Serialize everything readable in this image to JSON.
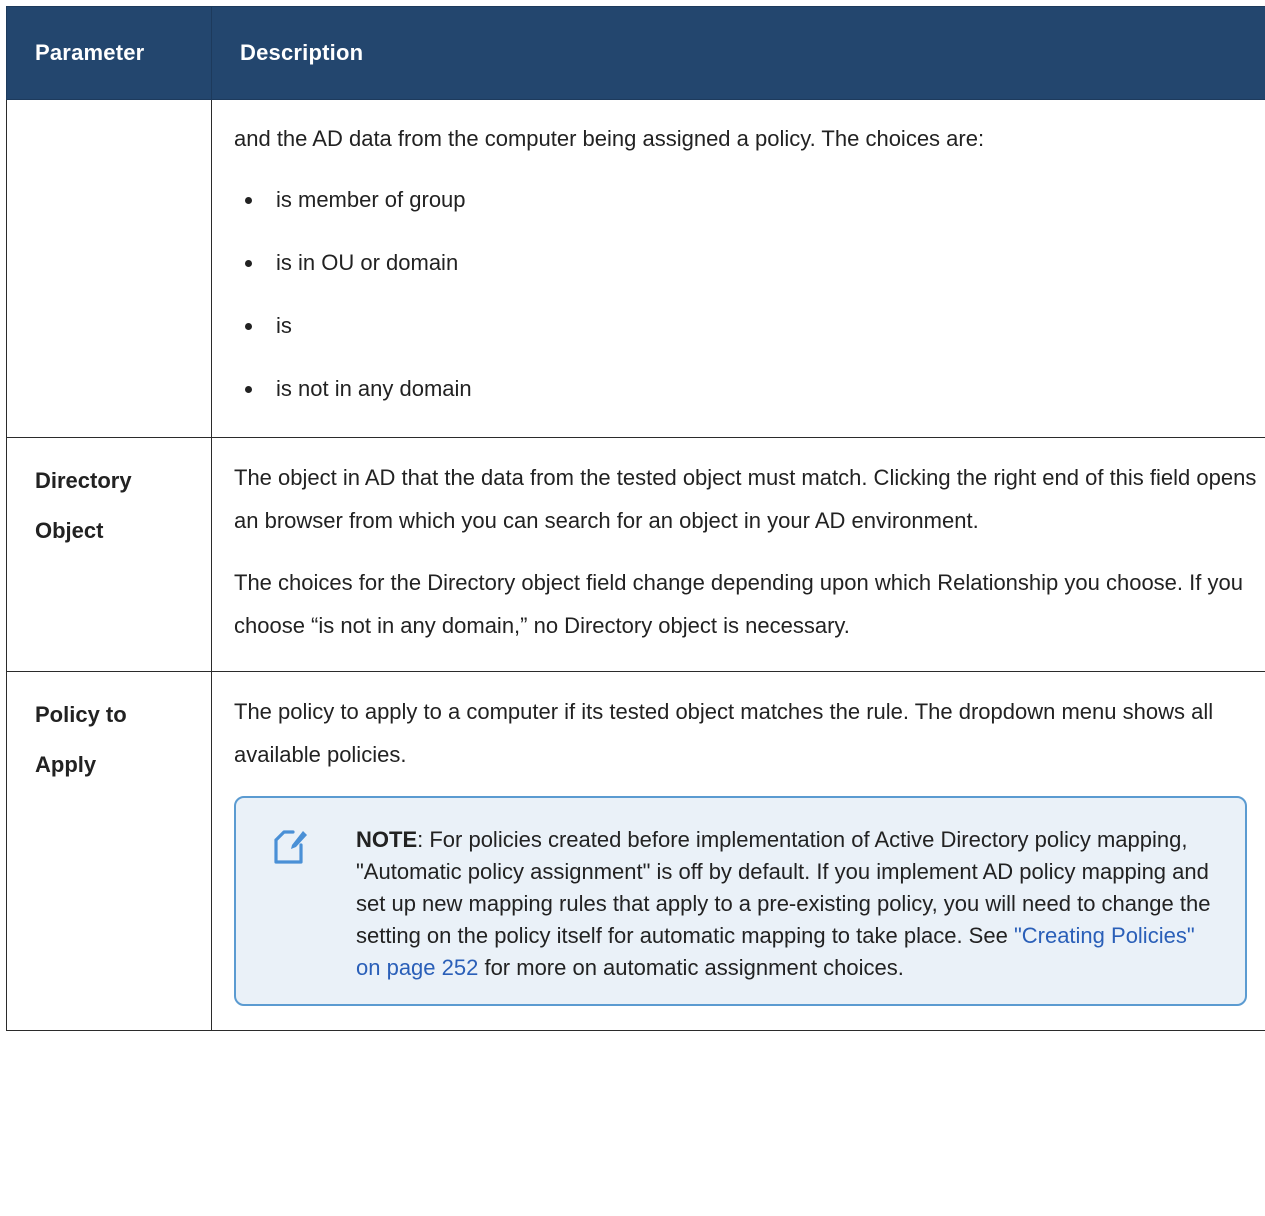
{
  "table": {
    "headers": [
      "Parameter",
      "Description"
    ],
    "rows": {
      "relationship": {
        "name": "",
        "intro": "and the AD data from the computer being assigned a policy. The choices are:",
        "choices": [
          "is member of group",
          "is in OU or domain",
          "is",
          "is not in any domain"
        ]
      },
      "directory_object": {
        "name": "Directory Object",
        "p1": "The object in AD that the data from the tested object must match. Clicking the right end of this field opens an browser from which you can search for an object in your AD environment.",
        "p2": "The choices for the Directory object field change depending upon which Relationship you choose. If you choose “is not in any domain,” no Directory object is necessary."
      },
      "policy_to_apply": {
        "name": "Policy to Apply",
        "p1": "The policy to apply to a computer if its tested object matches the rule. The dropdown menu shows all available policies.",
        "note": {
          "icon": "note-edit-icon",
          "label": "NOTE",
          "text_before": ": For policies created before implementation of Active Directory policy mapping, \"Automatic policy assignment\" is off by default. If you implement AD policy mapping and set up new mapping rules that apply to a pre-existing policy, you will need to change the setting on the policy itself for automatic mapping to take place. See ",
          "link": "\"Creating Policies\" on page 252",
          "text_after": " for more on automatic assignment choices."
        }
      }
    }
  },
  "colors": {
    "header_bg": "#23466e",
    "note_border": "#5b9bd1",
    "note_bg": "#eaf1f8",
    "link": "#2a5fb8"
  }
}
